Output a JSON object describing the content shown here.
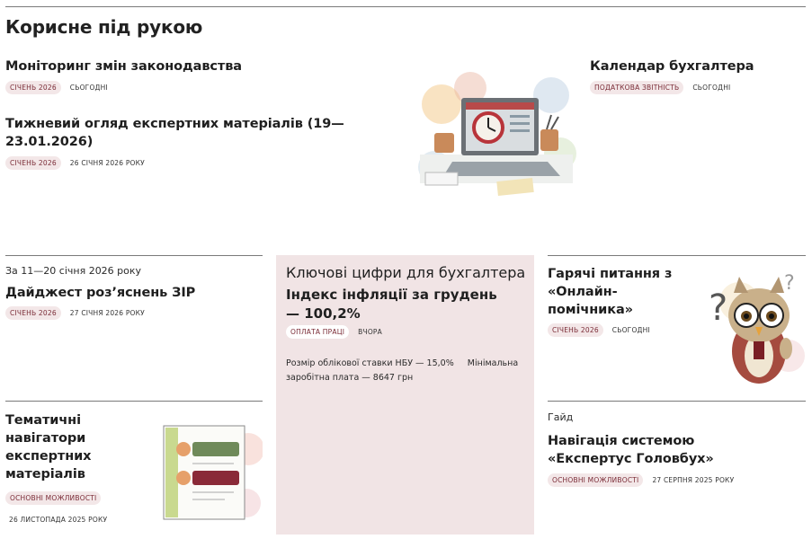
{
  "section": {
    "title": "Корисне під рукою"
  },
  "articles": {
    "monitoring": {
      "title": "Моніторинг змін законодавства",
      "tag": "Січень 2026",
      "date": "Сьогодні"
    },
    "weekly": {
      "title": "Тижневий огляд експертних матеріалів (19—23.01.2026)",
      "tag": "Січень 2026",
      "date": "26 січня 2026 року"
    },
    "calendar": {
      "title": "Календар бухгалтера",
      "tag": "Податкова звітність",
      "date": "Сьогодні"
    },
    "digest": {
      "kicker": "За 11—20 січня 2026 року",
      "title": "Дайджест роз’яснень ЗІР",
      "tag": "Січень 2026",
      "date": "27 січня 2026 року"
    },
    "key_figures": {
      "kicker": "Ключові цифри для бухгалтера",
      "title": "Індекс інфляції за грудень — 100,2%",
      "tag": "Оплата праці",
      "date": "Вчора",
      "facts": [
        "Розмір облікової ставки НБУ — 15,0%",
        "Мінімальна заробітна плата — 8647 грн"
      ]
    },
    "hot": {
      "title": "Гарячі питання з «Онлайн-помічника»",
      "tag": "Січень 2026",
      "date": "Сьогодні"
    },
    "navigators": {
      "title": "Тематичні навігатори експертних матеріалів",
      "tag": "Основні можливості",
      "date": "26 листопада 2025 року"
    },
    "guide": {
      "kicker": "Гайд",
      "title": "Навігація системою «Експертус Головбух»",
      "tag": "Основні можливості",
      "date": "27 серпня 2025 року"
    }
  },
  "colors": {
    "accent": "#7a2b36",
    "tag_bg": "#f3e7e8",
    "card_bg": "#f1e4e5"
  },
  "icons": [
    "laptop-clock-illustration",
    "owl-question-illustration",
    "navigator-panel-illustration"
  ]
}
